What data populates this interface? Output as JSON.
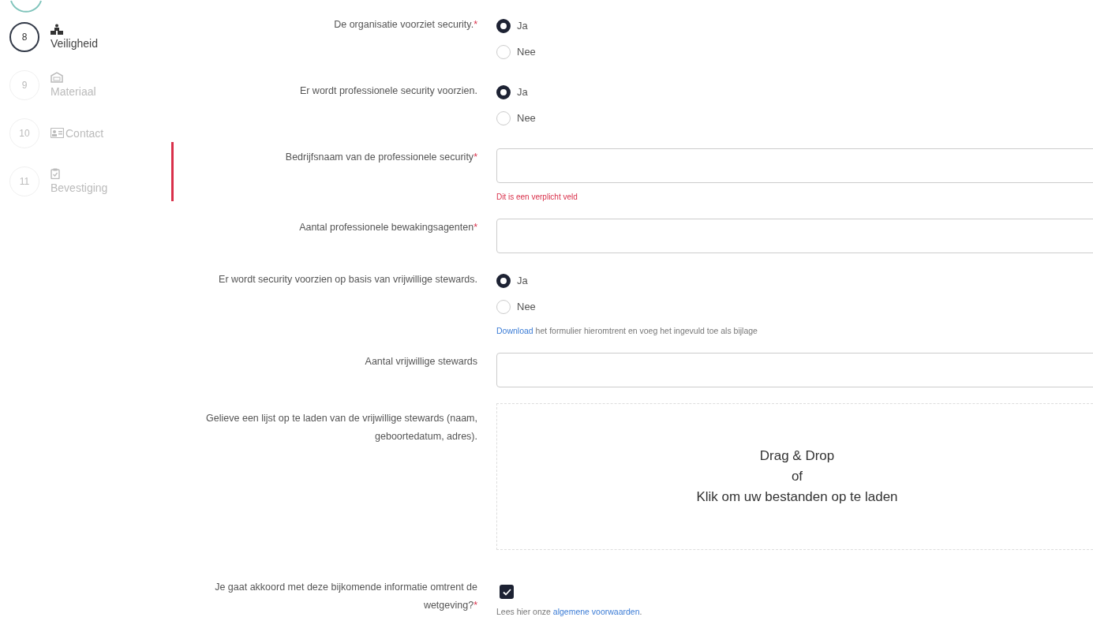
{
  "steps": [
    {
      "number": "8",
      "label": "Veiligheid",
      "kind": "people",
      "selected": true
    },
    {
      "number": "9",
      "label": "Materiaal",
      "kind": "building",
      "selected": false
    },
    {
      "number": "10",
      "label": "Contact",
      "kind": "card",
      "selected": false
    },
    {
      "number": "11",
      "label": "Bevestiging",
      "kind": "clipboard",
      "selected": false
    }
  ],
  "fields": [
    {
      "kind": "radio",
      "label": "De organisatie voorziet security.",
      "required_mark": "*",
      "options": [
        {
          "label": "Ja",
          "selected": true
        },
        {
          "label": "Nee",
          "selected": false
        }
      ]
    },
    {
      "kind": "radio",
      "label": "Er wordt professionele security voorzien.",
      "options": [
        {
          "label": "Ja",
          "selected": true
        },
        {
          "label": "Nee",
          "selected": false
        }
      ]
    },
    {
      "kind": "text",
      "label": "Bedrijfsnaam van de professionele security",
      "required_mark": "*",
      "error": "Dit is een verplicht veld"
    },
    {
      "kind": "text",
      "label": "Aantal professionele bewakingsagenten",
      "required_mark": "*"
    },
    {
      "kind": "radio",
      "label": "Er wordt security voorzien op basis van vrijwillige stewards.",
      "options": [
        {
          "label": "Ja",
          "selected": true
        },
        {
          "label": "Nee",
          "selected": false
        }
      ],
      "hint": {
        "link": "Download",
        "text": " het formulier hieromtrent en voeg het ingevuld toe als bijlage"
      }
    },
    {
      "kind": "text",
      "label": "Aantal vrijwillige stewards"
    },
    {
      "kind": "upload",
      "label": "Gelieve een lijst op te laden van de vrijwillige stewards (naam, geboortedatum, adres).",
      "lines": [
        "Drag & Drop",
        "of",
        "Klik om uw bestanden op te laden"
      ]
    },
    {
      "kind": "checkbox",
      "label": "Je gaat akkoord met deze bijkomende informatie omtrent de wetgeving?",
      "required_mark": "*",
      "checked": true,
      "hint": {
        "text": "Lees hier onze ",
        "link": "algemene voorwaarden",
        "after": "."
      }
    }
  ]
}
